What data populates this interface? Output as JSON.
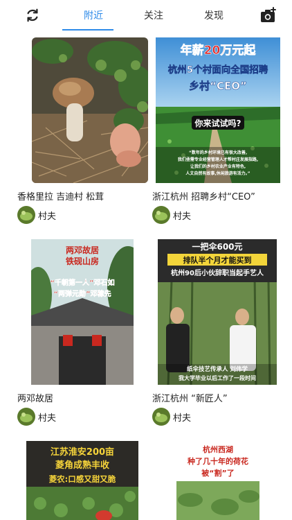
{
  "header": {
    "refresh_icon": "refresh-icon",
    "camera_icon": "camera-icon",
    "tabs": [
      {
        "label": "附近",
        "active": true
      },
      {
        "label": "关注",
        "active": false
      },
      {
        "label": "发现",
        "active": false
      }
    ],
    "accent": "#2d8ae8"
  },
  "feed": [
    {
      "caption": "香格里拉 吉迪村 松茸",
      "author": "村夫",
      "overlay_lines": []
    },
    {
      "caption": "浙江杭州 招聘乡村“CEO”",
      "author": "村夫",
      "overlay_lines": [
        "年薪20万元起",
        "杭州5个村面向全国招聘",
        "乡村“CEO”",
        "你来试试吗?",
        "“数年的乡村环境已有很大改善,",
        "我们亟需专业经营管理人才帮村庄发展指路,",
        "让我们的乡村农业产业有特色,",
        "人文自然有故事,休闲旅游有活力。”"
      ]
    },
    {
      "caption": "两邓故居",
      "author": "村夫",
      "overlay_lines": [
        "两邓故居",
        "铁砚山房",
        "“千朝第一人”邓石如",
        "“两弹元勋”邓稼先"
      ]
    },
    {
      "caption": "浙江杭州 “新匠人”",
      "author": "村夫",
      "overlay_lines": [
        "一把伞600元",
        "排队半个月才能买到",
        "杭州90后小伙辞职当起手艺人",
        "纸伞技艺传承人  刘伟学",
        "我大学毕业以后工作了一段时间"
      ]
    },
    {
      "caption": "",
      "author": "",
      "overlay_lines": [
        "江苏淮安200亩",
        "菱角成熟丰收",
        "菱农:口感又甜又脆"
      ]
    },
    {
      "caption": "",
      "author": "",
      "overlay_lines": [
        "杭州西湖",
        "种了几十年的荷花",
        "被“割”了"
      ]
    }
  ]
}
